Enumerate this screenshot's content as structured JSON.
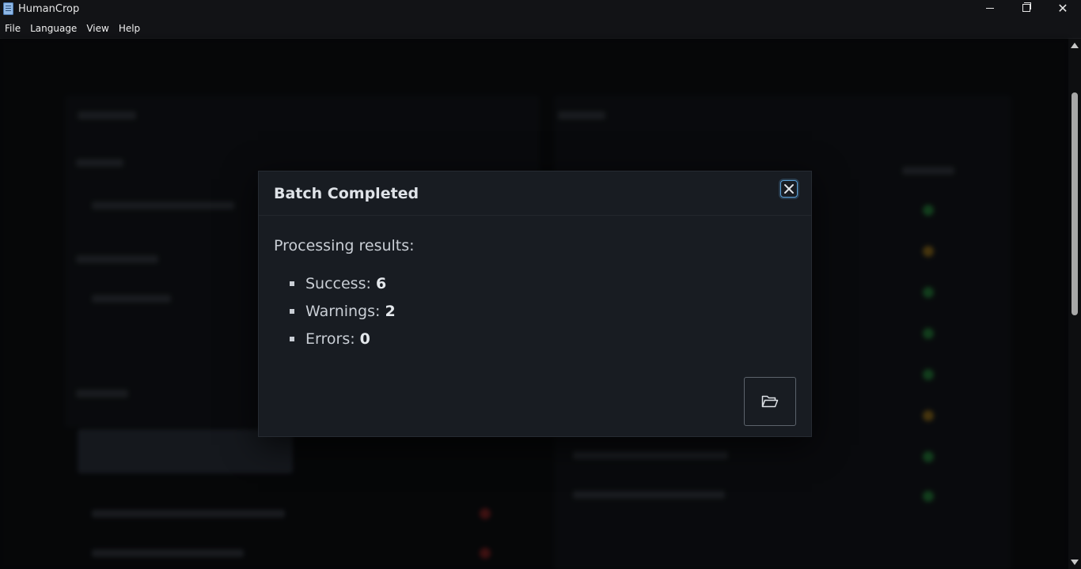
{
  "window": {
    "title": "HumanCrop"
  },
  "menu": {
    "items": [
      "File",
      "Language",
      "View",
      "Help"
    ]
  },
  "dialog": {
    "title": "Batch Completed",
    "results_heading": "Processing results:",
    "results": [
      {
        "label": "Success: ",
        "value": "6"
      },
      {
        "label": "Warnings: ",
        "value": "2"
      },
      {
        "label": "Errors: ",
        "value": "0"
      }
    ],
    "close_icon": "close-icon",
    "open_folder_icon": "folder-open-icon"
  },
  "colors": {
    "dialog_background": "#181c22",
    "focus_ring": "#5aa0d8",
    "text": "#c9ced5"
  }
}
